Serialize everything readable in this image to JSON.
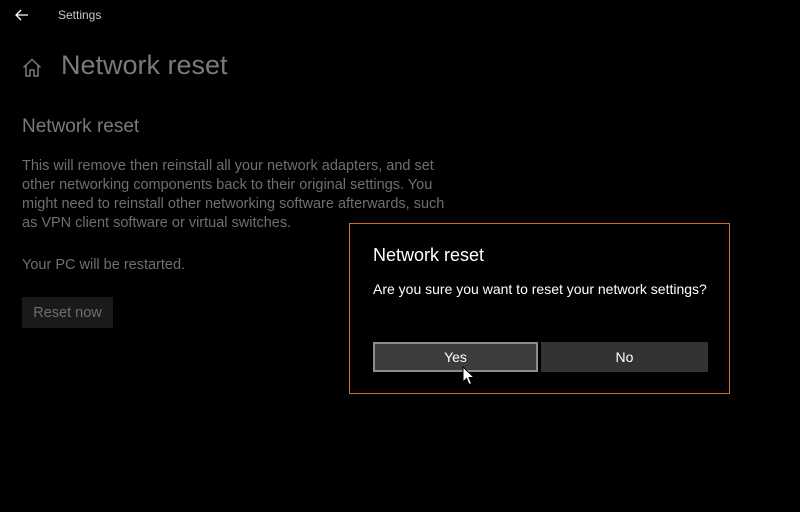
{
  "titlebar": {
    "back_icon": "arrow-left-icon",
    "app_title": "Settings"
  },
  "page": {
    "home_icon": "home-icon",
    "title": "Network reset",
    "section_title": "Network reset",
    "description": "This will remove then reinstall all your network adapters, and set other networking components back to their original settings. You might need to reinstall other networking software afterwards, such as VPN client software or virtual switches.",
    "restart_note": "Your PC will be restarted.",
    "reset_now_label": "Reset now"
  },
  "dialog": {
    "title": "Network reset",
    "message": "Are you sure you want to reset your network settings?",
    "yes_label": "Yes",
    "no_label": "No",
    "border_color": "#d4701e"
  },
  "cursor_icon": "mouse-pointer-icon"
}
